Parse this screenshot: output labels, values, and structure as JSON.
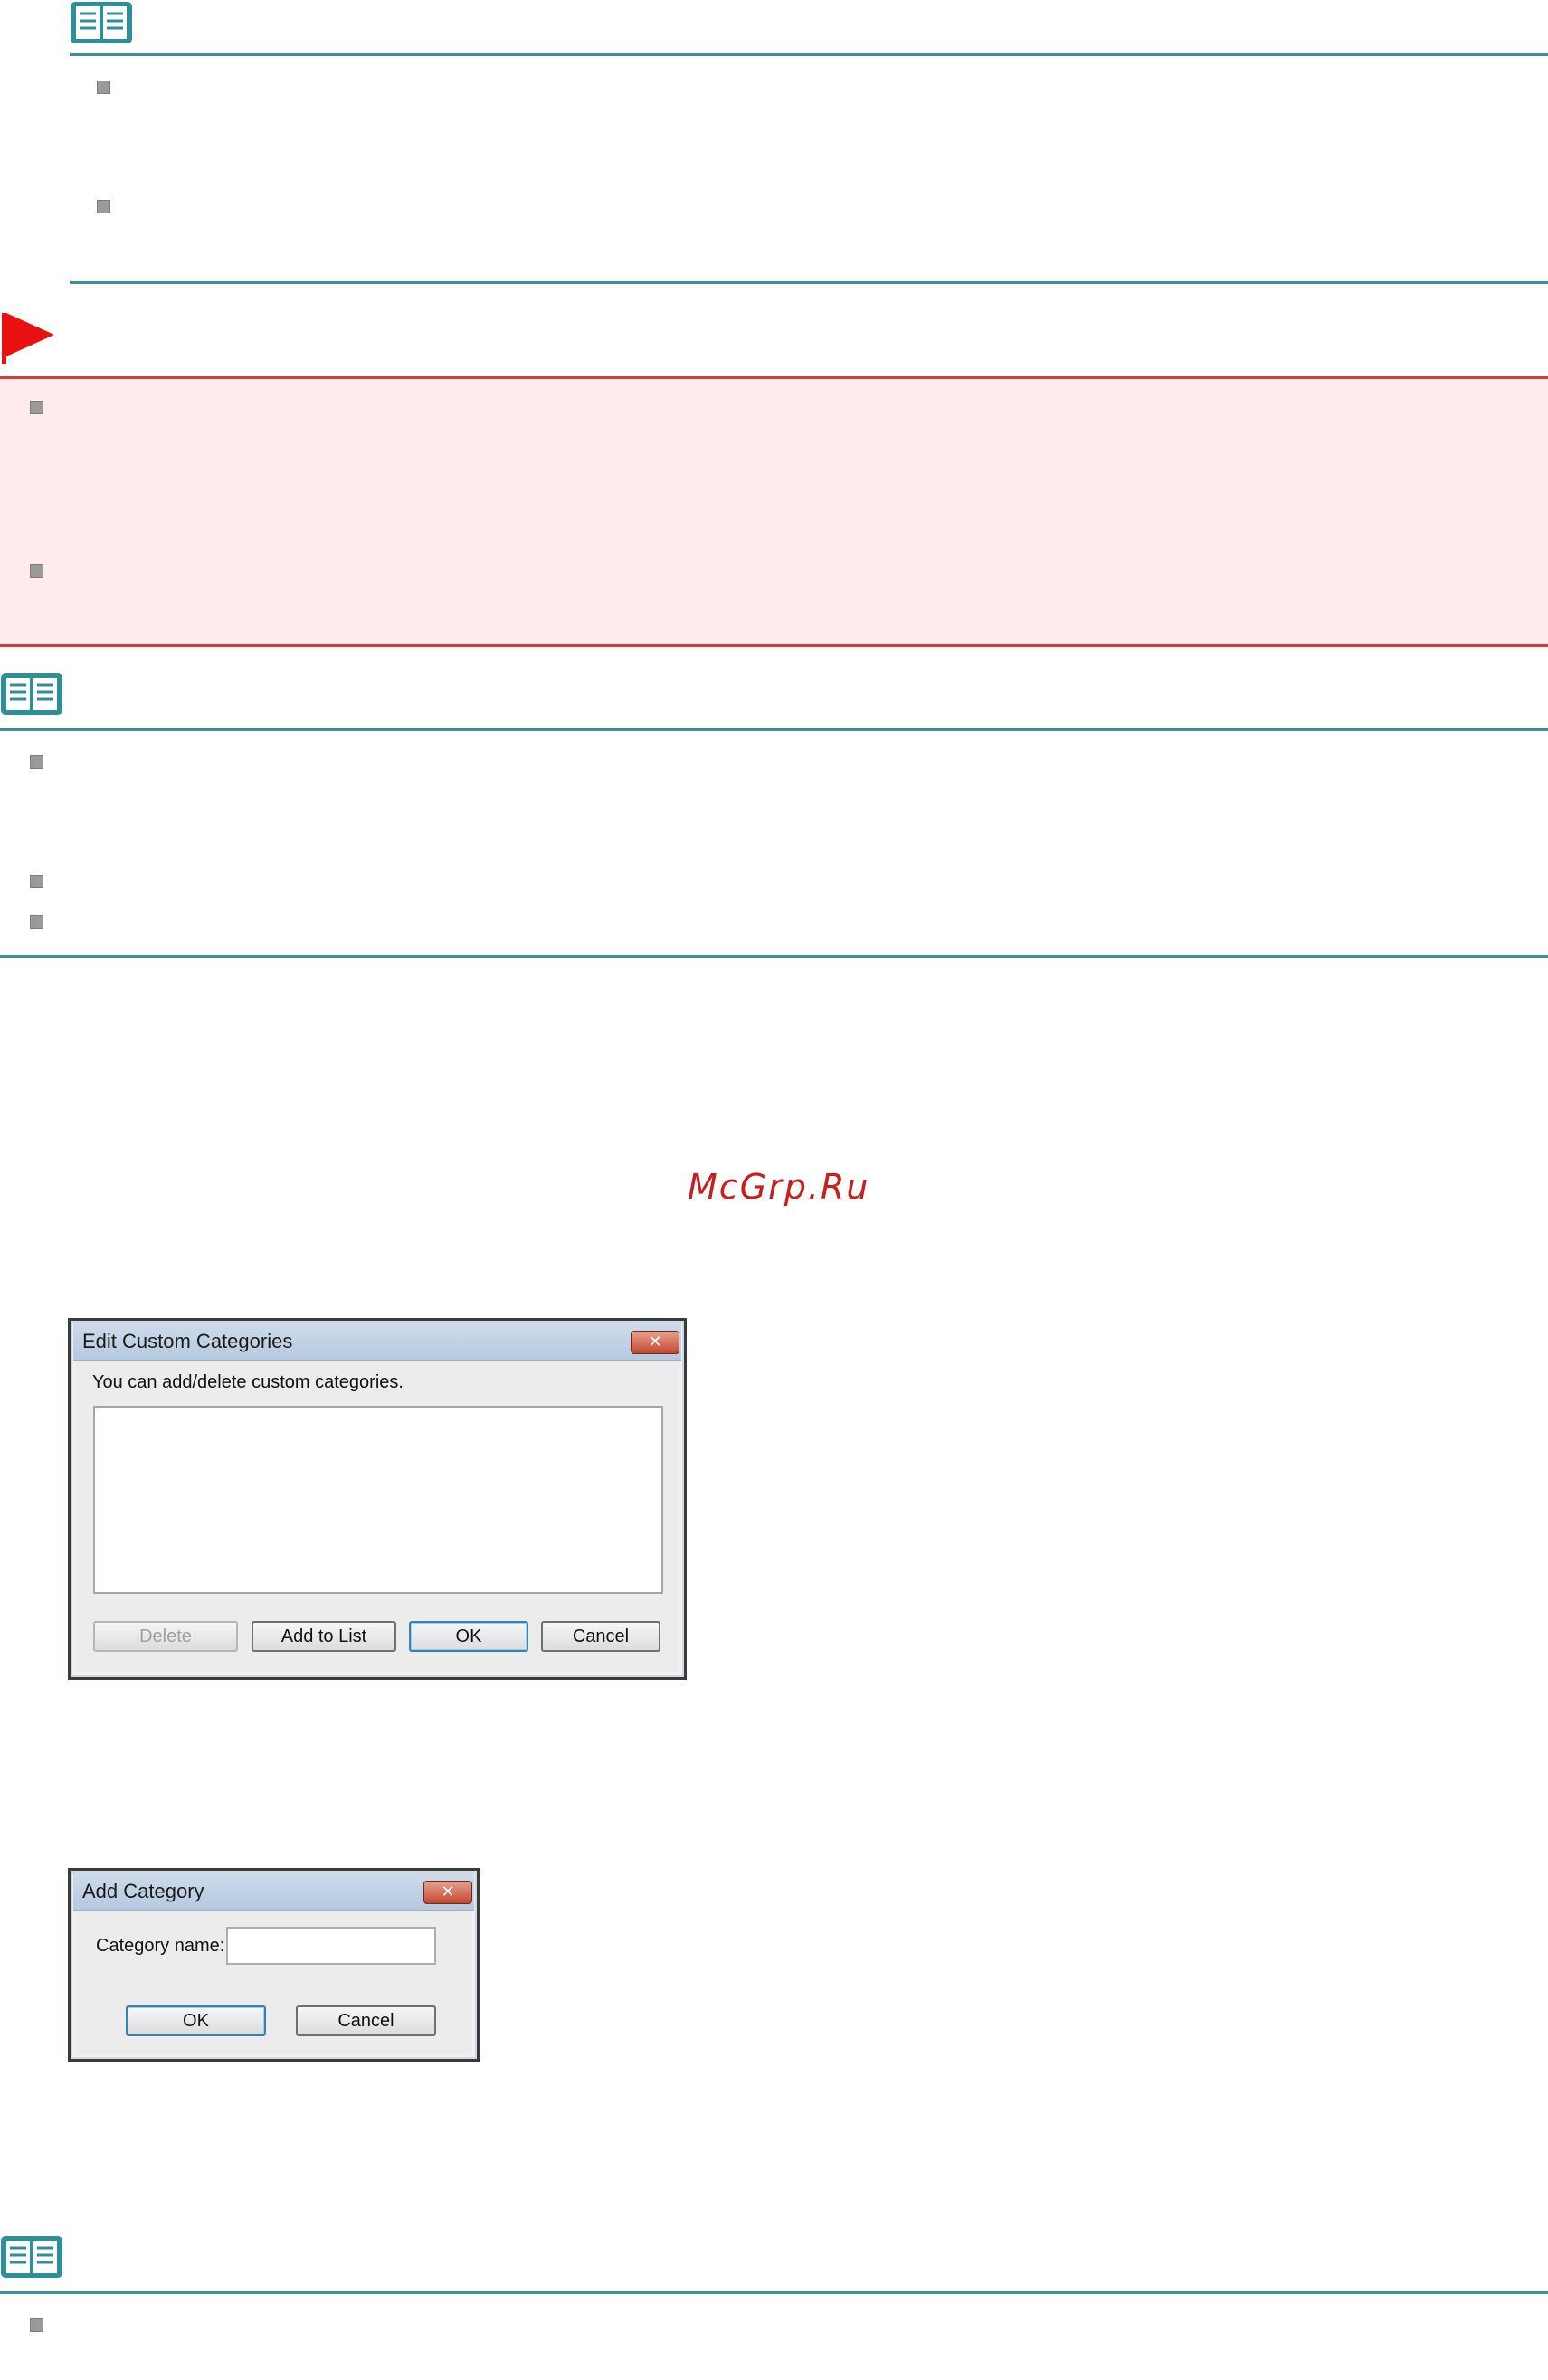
{
  "watermark": "McGrp.Ru",
  "edit_dialog": {
    "title": "Edit Custom Categories",
    "close_glyph": "✕",
    "instruction": "You can add/delete custom categories.",
    "buttons": {
      "delete": "Delete",
      "add_to_list": "Add to List",
      "ok": "OK",
      "cancel": "Cancel"
    }
  },
  "add_dialog": {
    "title": "Add Category",
    "close_glyph": "✕",
    "field_label": "Category name:",
    "field_value": "",
    "buttons": {
      "ok": "OK",
      "cancel": "Cancel"
    }
  },
  "colors": {
    "note_rule": "#3a8f98",
    "important_rule": "#d43a3a",
    "important_background": "#fdeceb",
    "flag": "#e81010",
    "watermark": "#c81e1e"
  }
}
